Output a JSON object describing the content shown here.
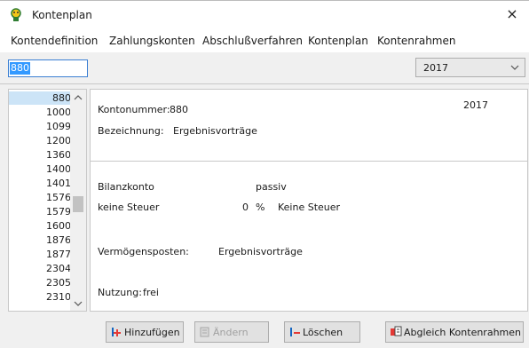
{
  "window": {
    "title": "Kontenplan",
    "close_glyph": "×",
    "icon": "app-icon"
  },
  "menu": [
    "Kontendefinition",
    "Zahlungskonten",
    "Abschlußverfahren",
    "Kontenplan",
    "Kontenrahmen"
  ],
  "search": {
    "value": "880"
  },
  "year_select": {
    "value": "2017"
  },
  "account_list": {
    "items": [
      "880",
      "1000",
      "1099",
      "1200",
      "1360",
      "1400",
      "1401",
      "1576",
      "1579",
      "1600",
      "1876",
      "1877",
      "2304",
      "2305",
      "2310"
    ],
    "selected": "880"
  },
  "details": {
    "kontonummer_label": "Kontonummer:",
    "kontonummer_value": "880",
    "year": "2017",
    "bezeichnung_label": "Bezeichnung:",
    "bezeichnung_value": "Ergebnisvorträge",
    "bilanz_label": "Bilanzkonto",
    "bilanz_value": "passiv",
    "steuer_label": "keine Steuer",
    "steuer_percent": "0",
    "steuer_unit": "%",
    "steuer_value": "Keine Steuer",
    "vermoegen_label": "Vermögensposten:",
    "vermoegen_value": "Ergebnisvorträge",
    "nutzung_label": "Nutzung:",
    "nutzung_value": "frei"
  },
  "buttons": {
    "add": "Hinzufügen",
    "change": "Ändern",
    "delete": "Löschen",
    "sync": "Abgleich Kontenrahmen"
  },
  "colors": {
    "accent": "#3399ff",
    "selection": "#cce4f7",
    "focus_border": "#3b7fd3",
    "icon_red": "#e53935",
    "icon_blue": "#1565c0"
  }
}
